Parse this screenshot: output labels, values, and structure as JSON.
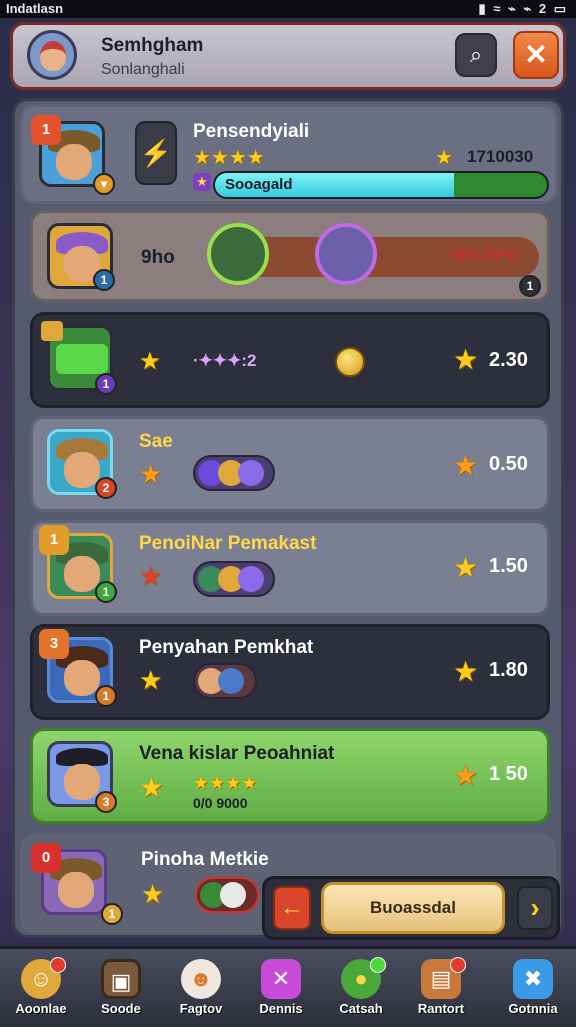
{
  "status": {
    "left": "Indatlasn",
    "right": "▮ ≈ ⌁ ⌁ 2 ▭"
  },
  "header": {
    "title": "Semhgham",
    "subtitle": "Sonlanghali"
  },
  "top_card": {
    "rank": "1",
    "title": "Pensendyiali",
    "score": "1710030",
    "bar_label": "Sooagald",
    "bar_progress": 0.72,
    "rank_color": "#e3522a"
  },
  "match_card": {
    "label": "9ho",
    "result": "MSLDPO",
    "badge": "1"
  },
  "rows": [
    {
      "name": "",
      "mid_text": "·✦✦✦:2",
      "value": "2.30",
      "rank": "",
      "style": "dark"
    },
    {
      "name": "Sae",
      "mid_text": "",
      "value": "0.50",
      "rank": "2",
      "style": "light"
    },
    {
      "name": "PenoiNar Pemakast",
      "mid_text": "",
      "value": "1.50",
      "rank": "1",
      "style": "light"
    },
    {
      "name": "Penyahan Pemkhat",
      "mid_text": "",
      "value": "1.80",
      "rank": "3",
      "style": "dark"
    },
    {
      "name": "Vena kislar Peoahniat",
      "mid_text": "0/0 9000",
      "value": "1 50",
      "rank": "3",
      "style": "green"
    },
    {
      "name": "Pinoha Metkie",
      "mid_text": "",
      "value": "",
      "rank": "0",
      "style": "light"
    }
  ],
  "footer": {
    "main_button": "Buoassdal",
    "left_arrow": "←",
    "right_arrow": "›"
  },
  "nav": [
    {
      "label": "Aoonlae",
      "icon": "character-icon"
    },
    {
      "label": "Soode",
      "icon": "frame-icon"
    },
    {
      "label": "Fagtov",
      "icon": "ghost-icon"
    },
    {
      "label": "Dennis",
      "icon": "cross-icon"
    },
    {
      "label": "Catsah",
      "icon": "coin-icon"
    },
    {
      "label": "Rantort",
      "icon": "chest-icon"
    },
    {
      "label": "Gotnnia",
      "icon": "puzzle-icon"
    }
  ]
}
